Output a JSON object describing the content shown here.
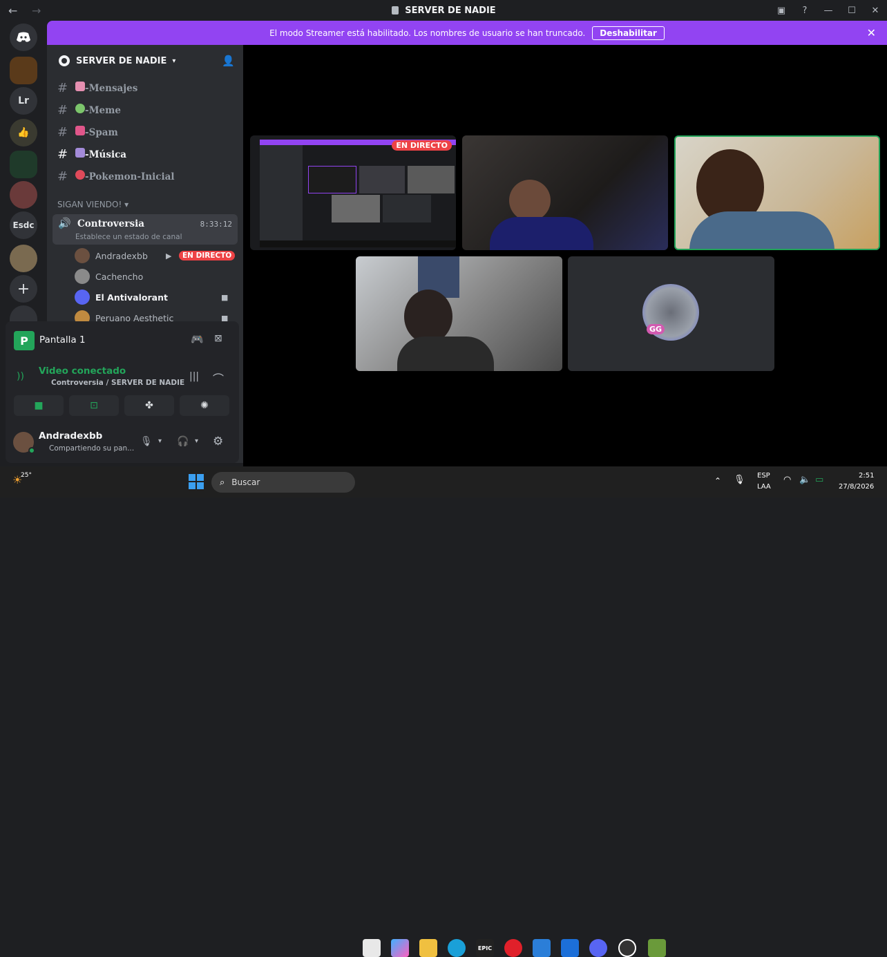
{
  "window": {
    "title": "SERVER DE NADIE",
    "back_icon": "←",
    "forward_icon": "→"
  },
  "banner": {
    "text": "El modo Streamer está habilitado. Los nombres de usuario se han truncado.",
    "button": "Deshabilitar"
  },
  "servers": [
    {
      "label": "Lr"
    },
    {
      "label": "Esdc"
    }
  ],
  "server": {
    "name": "SERVER DE NADIE"
  },
  "channels": [
    {
      "name": "-Mensajes",
      "color": "#e58fb0"
    },
    {
      "name": "-Meme",
      "color": "#7cc56b"
    },
    {
      "name": "-Spam",
      "color": "#e0568a"
    },
    {
      "name": "-Música",
      "color": "#a38bd9"
    },
    {
      "name": "-Pokemon-Inicial",
      "color": "#e04a5a"
    }
  ],
  "category": "SIGAN VIENDO!",
  "voice_channel": {
    "name": "Controversia",
    "timer": "8:33:12",
    "status": "Establece un estado de canal"
  },
  "voice_users": [
    {
      "name": "Andradexbb",
      "badge": "EN DIRECTO"
    },
    {
      "name": "Cachencho"
    },
    {
      "name": "El Antivalorant"
    },
    {
      "name": "Peruano Aesthetic"
    }
  ],
  "panel": {
    "stream_name": "Pantalla 1",
    "video_status": "Video conectado",
    "video_location": "Controversia / SERVER DE NADIE",
    "username": "Andradexbb",
    "user_status": "Compartiendo su pan..."
  },
  "stage": {
    "live_badge": "EN DIRECTO",
    "avatar_label": "GG"
  },
  "taskbar": {
    "weather": "25°",
    "search": "Buscar",
    "lang1": "ESP",
    "lang2": "LAA",
    "time": "2:51",
    "date": "27/8/2026"
  },
  "colors": {
    "accent": "#9244f2",
    "online": "#23a55a",
    "live": "#ed4245"
  }
}
